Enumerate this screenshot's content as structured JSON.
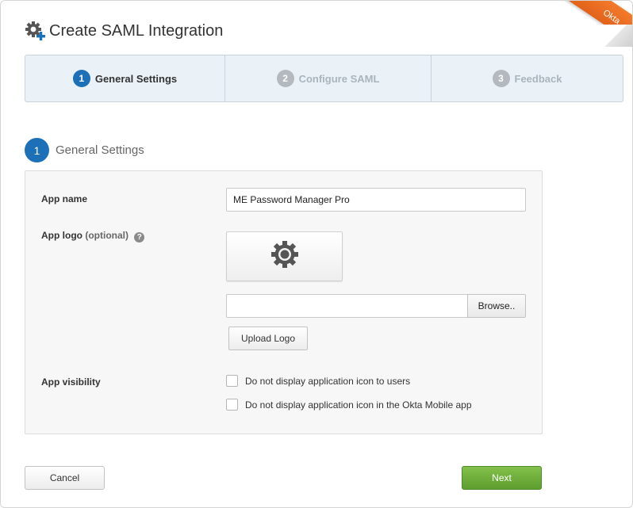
{
  "colors": {
    "accent": "#1b70b7",
    "next_button": "#6aab37",
    "ribbon": "#ec6e22"
  },
  "ribbon": {
    "text": "Okta"
  },
  "header": {
    "title": "Create SAML Integration",
    "icon": "gear-add-icon"
  },
  "wizard": {
    "steps": [
      {
        "number": "1",
        "label": "General Settings",
        "state": "active"
      },
      {
        "number": "2",
        "label": "Configure SAML",
        "state": "inactive"
      },
      {
        "number": "3",
        "label": "Feedback",
        "state": "inactive"
      }
    ]
  },
  "section": {
    "number": "1",
    "title": "General Settings"
  },
  "form": {
    "app_name": {
      "label": "App name",
      "value": "ME Password Manager Pro"
    },
    "app_logo": {
      "label": "App logo",
      "optional": "(optional)",
      "help_icon": "?",
      "placeholder_icon": "gear-icon",
      "file_value": "",
      "browse_label": "Browse..",
      "upload_label": "Upload Logo"
    },
    "app_visibility": {
      "label": "App visibility",
      "options": [
        {
          "label": "Do not display application icon to users",
          "checked": false
        },
        {
          "label": "Do not display application icon in the Okta Mobile app",
          "checked": false
        }
      ]
    }
  },
  "footer": {
    "cancel_label": "Cancel",
    "next_label": "Next"
  }
}
